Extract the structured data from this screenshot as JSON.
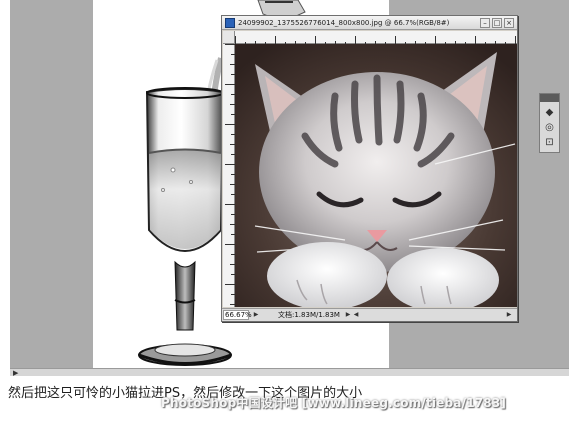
{
  "document_window": {
    "title": "24099902_1375526776014_800x800.jpg @ 66.7%(RGB/8#)",
    "zoom": "66.67%",
    "doc_info": "文档:1.83M/1.83M"
  },
  "caption": {
    "text": "然后把这只可怜的小猫拉进PS，然后修改一下这个图片的大小",
    "watermark": "PhotoShop中国设计吧 [www.lineeg.com/tieba/1783]"
  },
  "palette": {
    "icons": [
      "layers-icon",
      "channels-icon",
      "paths-icon"
    ]
  },
  "colors": {
    "workspace": "#acacac",
    "title_icon": "#2a62b8"
  }
}
